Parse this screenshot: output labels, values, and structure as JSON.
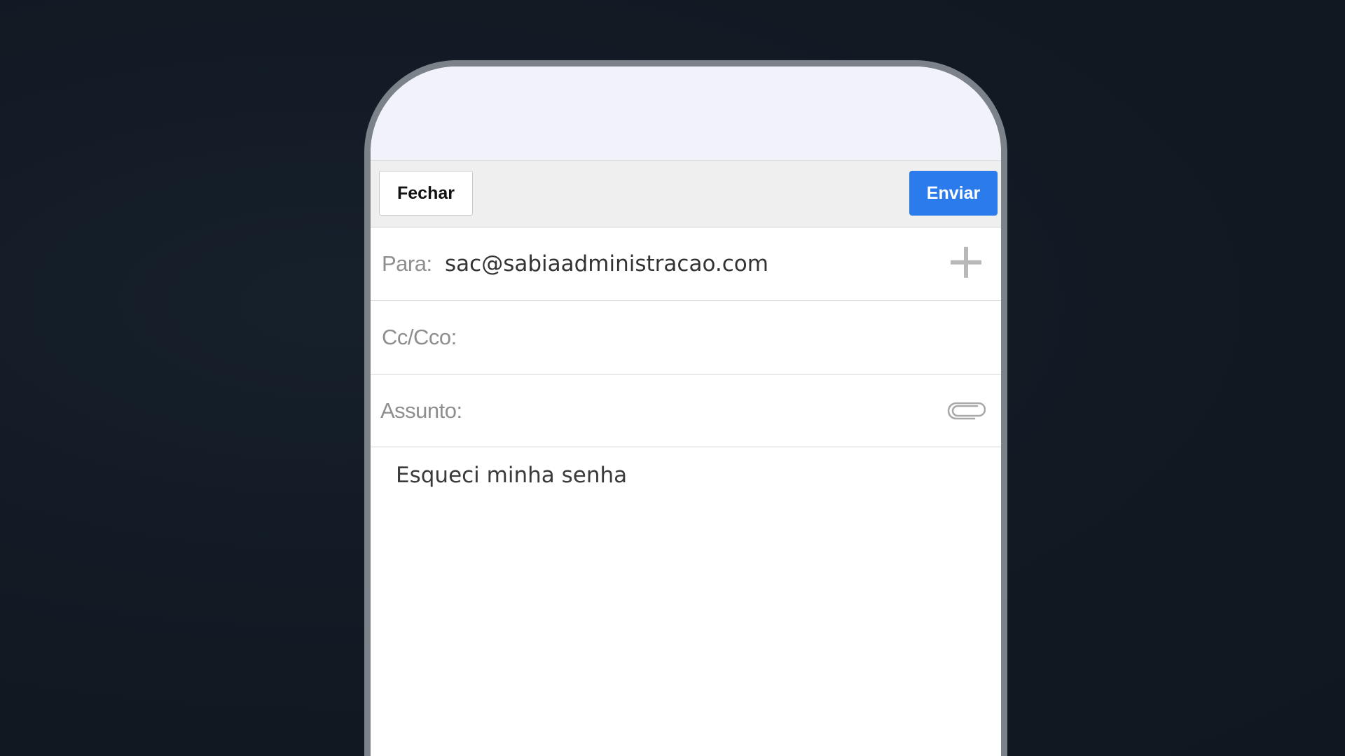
{
  "toolbar": {
    "close_label": "Fechar",
    "send_label": "Enviar"
  },
  "fields": {
    "to_label": "Para:",
    "to_value": "sac@sabiaadministracao.com",
    "cc_label": "Cc/Cco:",
    "subject_label": "Assunto:"
  },
  "message": {
    "body": "Esqueci minha senha"
  },
  "icons": {
    "add_recipient": "plus-icon",
    "attachment": "paperclip-icon"
  },
  "colors": {
    "send_button": "#2b7bec",
    "background": "#111923",
    "device_frame": "#7c8289"
  }
}
